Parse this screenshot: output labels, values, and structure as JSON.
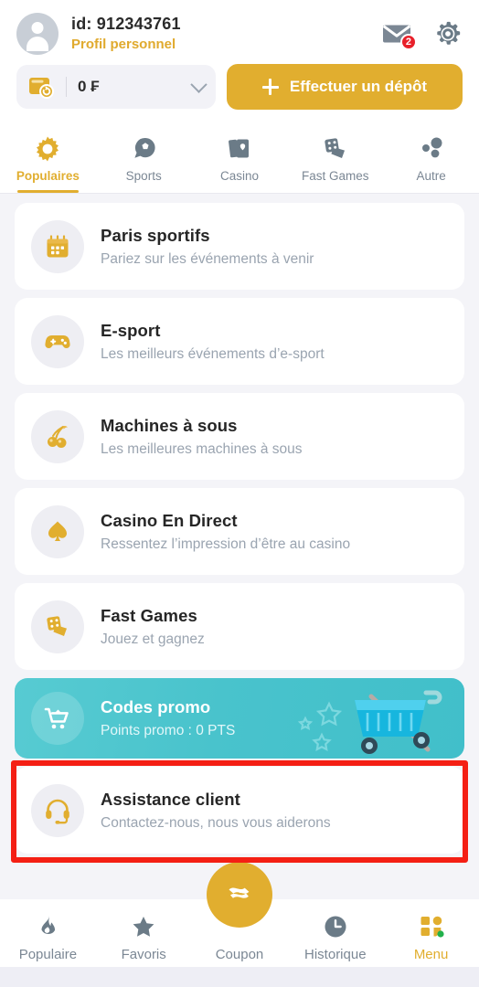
{
  "header": {
    "avatar_name": "user-avatar",
    "user_id": "id: 912343761",
    "profile_link": "Profil personnel",
    "mail_badge_count": "2",
    "wallet_balance": "0 ₣",
    "deposit_label": "Effectuer un dépôt"
  },
  "tabs": [
    {
      "label": "Populaires",
      "icon": "sunburst-icon",
      "active": true
    },
    {
      "label": "Sports",
      "icon": "football-icon",
      "active": false
    },
    {
      "label": "Casino",
      "icon": "cards-icon",
      "active": false
    },
    {
      "label": "Fast Games",
      "icon": "dice-icon",
      "active": false
    },
    {
      "label": "Autre",
      "icon": "dots-icon",
      "active": false
    }
  ],
  "list": [
    {
      "title": "Paris sportifs",
      "subtitle": "Pariez sur les événements à venir",
      "icon": "calendar-icon"
    },
    {
      "title": "E-sport",
      "subtitle": "Les meilleurs événements d’e-sport",
      "icon": "gamepad-icon"
    },
    {
      "title": "Machines à sous",
      "subtitle": "Les meilleures machines à sous",
      "icon": "cherry-icon"
    },
    {
      "title": "Casino En Direct",
      "subtitle": "Ressentez l’impression d’être au casino",
      "icon": "spade-icon"
    },
    {
      "title": "Fast Games",
      "subtitle": "Jouez et gagnez",
      "icon": "dice-icon"
    }
  ],
  "promo": {
    "title": "Codes promo",
    "subtitle": "Points promo : 0 PTS",
    "icon": "shopping-cart-icon"
  },
  "support": {
    "title": "Assistance client",
    "subtitle": "Contactez-nous, nous vous aiderons",
    "icon": "headset-icon"
  },
  "bottom_nav": [
    {
      "label": "Populaire",
      "icon": "flame-icon",
      "active": false
    },
    {
      "label": "Favoris",
      "icon": "star-icon",
      "active": false
    },
    {
      "label": "Coupon",
      "icon": "ticket-icon",
      "active": false
    },
    {
      "label": "Historique",
      "icon": "clock-icon",
      "active": false
    },
    {
      "label": "Menu",
      "icon": "grid-icon",
      "active": true
    }
  ],
  "colors": {
    "accent_gold": "#e1ae2f",
    "promo_teal": "#49c3cc",
    "badge_red": "#e8202a",
    "annotation_red": "#f41f14",
    "muted_gray": "#7b8794"
  }
}
